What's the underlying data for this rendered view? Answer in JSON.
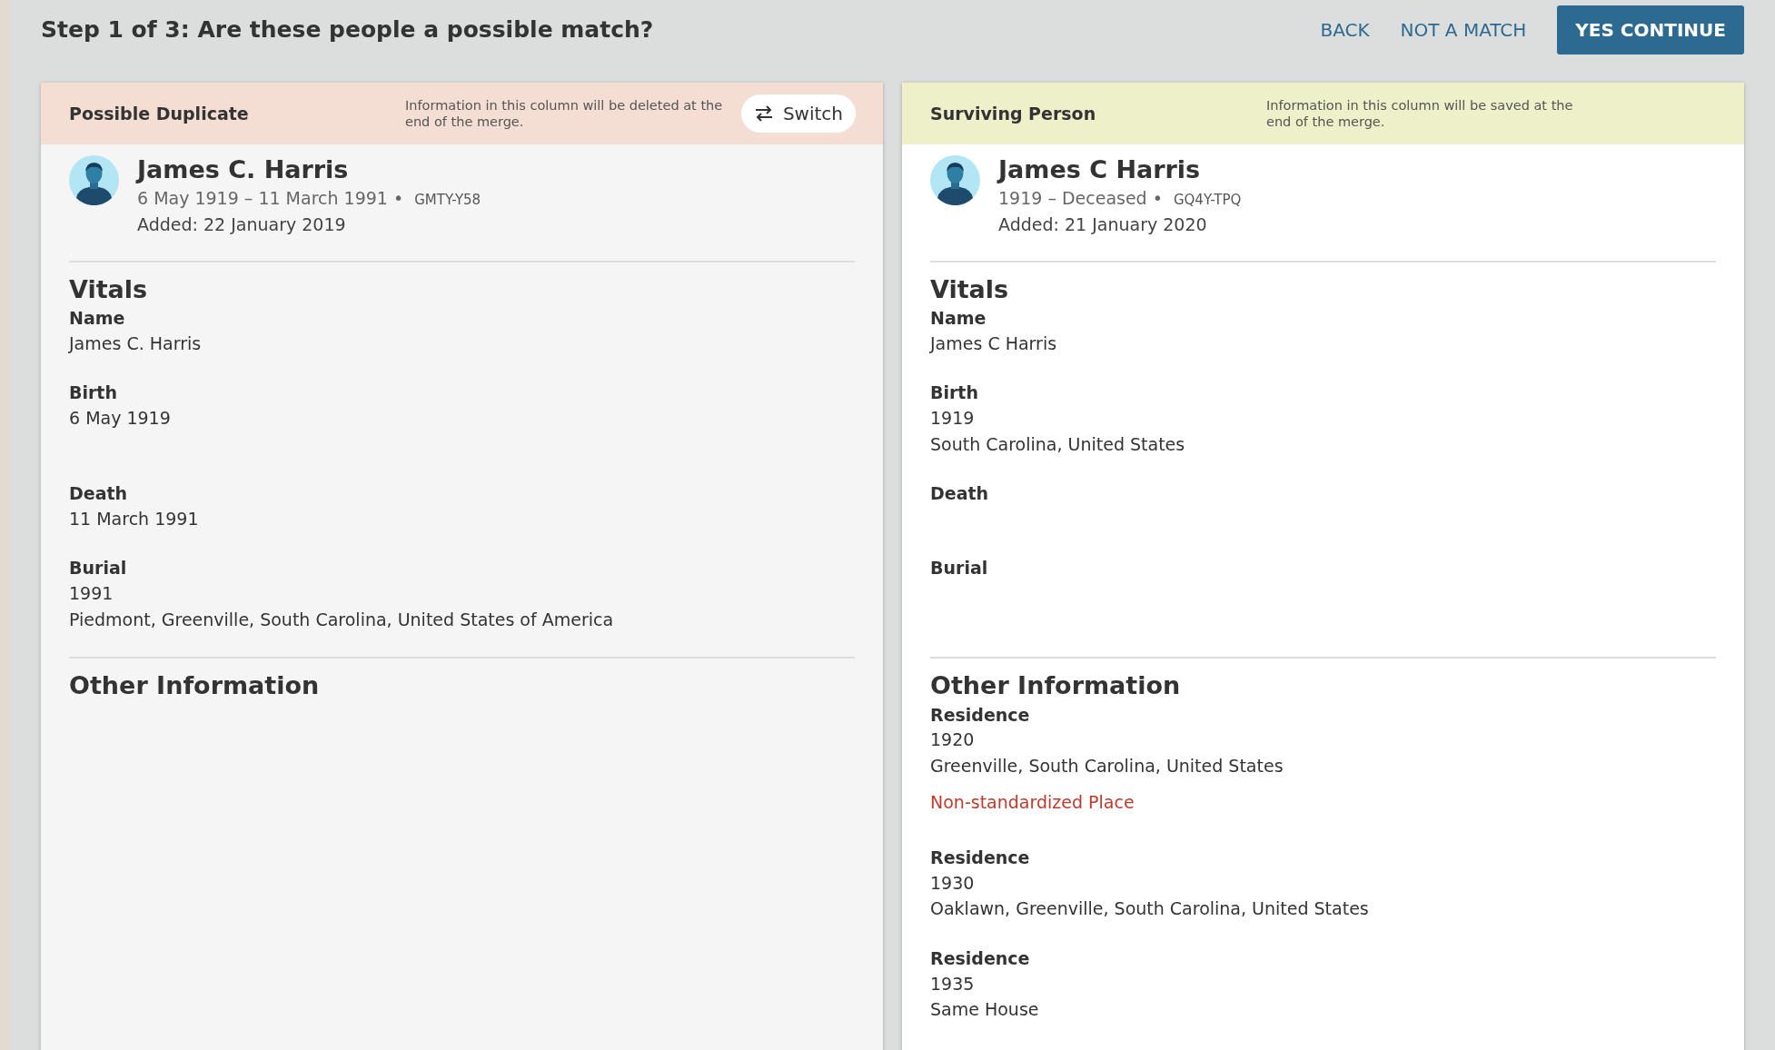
{
  "title": "Step 1 of 3: Are these people a possible match?",
  "actions": [
    {
      "label": "BACK",
      "kind": "link"
    },
    {
      "label": "NOT A MATCH",
      "kind": "link"
    },
    {
      "label": "YES CONTINUE",
      "kind": "primary"
    }
  ],
  "columns": [
    {
      "kind": "duplicate",
      "heading": "Possible Duplicate",
      "note": "Information in this column will be deleted at the end of the merge.",
      "switch_label": "Switch",
      "person": {
        "name": "James C. Harris",
        "lifespan": "6 May 1919 – 11 March 1991 •",
        "id": "GMTY-Y58",
        "added": "Added: 22 January 2019"
      },
      "sections": [
        {
          "title": "Vitals",
          "facts": [
            {
              "label": "Name",
              "lines": [
                "James C. Harris"
              ]
            },
            {
              "label": "Birth",
              "lines": [
                "6 May 1919"
              ]
            },
            {
              "label": "Death",
              "lines": [
                "11 March 1991"
              ]
            },
            {
              "label": "Burial",
              "lines": [
                "1991",
                "Piedmont, Greenville, South Carolina, United States of America"
              ]
            }
          ]
        },
        {
          "title": "Other Information"
        }
      ]
    },
    {
      "kind": "surviving",
      "heading": "Surviving Person",
      "note": "Information in this column will be saved at the end of the merge.",
      "person": {
        "name": "James C Harris",
        "lifespan": "1919 – Deceased •",
        "id": "GQ4Y-TPQ",
        "added": "Added: 21 January 2020"
      },
      "sections": [
        {
          "title": "Vitals",
          "facts": [
            {
              "label": "Name",
              "lines": [
                "James C Harris"
              ]
            },
            {
              "label": "Birth",
              "lines": [
                "1919",
                "South Carolina, United States"
              ]
            },
            {
              "label": "Death"
            },
            {
              "label": "Burial"
            }
          ]
        },
        {
          "title": "Other Information",
          "facts": [
            {
              "label": "Residence",
              "lines": [
                "1920",
                "Greenville, South Carolina, United States"
              ],
              "warning": "Non-standardized Place"
            },
            {
              "label": "Residence",
              "lines": [
                "1930",
                "Oaklawn, Greenville, South Carolina, United States"
              ]
            },
            {
              "label": "Residence",
              "lines": [
                "1935",
                "Same House"
              ]
            }
          ]
        }
      ]
    }
  ]
}
